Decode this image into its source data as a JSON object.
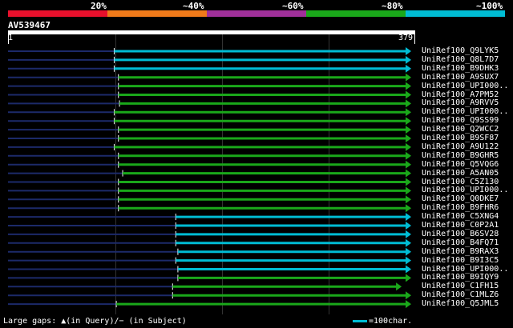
{
  "legend": {
    "labels": [
      "20%",
      "~40%",
      "~60%",
      "~80%",
      "~100%"
    ],
    "colors": [
      "#e8102c",
      "#f07a1a",
      "#a0309a",
      "#1aa81a",
      "#00bcd4"
    ]
  },
  "query": {
    "name": "AV539467",
    "start": "1",
    "end": "379",
    "length": 379
  },
  "hits": [
    {
      "label": "UniRef100_Q9LYK5",
      "start": 100,
      "end": 379,
      "identity": "~100%"
    },
    {
      "label": "UniRef100_Q8L7D7",
      "start": 100,
      "end": 379,
      "identity": "~100%"
    },
    {
      "label": "UniRef100_B9DHK3",
      "start": 100,
      "end": 379,
      "identity": "~100%"
    },
    {
      "label": "UniRef100_A9SUX7",
      "start": 104,
      "end": 379,
      "identity": "~80%"
    },
    {
      "label": "UniRef100_UPI000..",
      "start": 104,
      "end": 379,
      "identity": "~80%"
    },
    {
      "label": "UniRef100_A7PM52",
      "start": 104,
      "end": 379,
      "identity": "~80%"
    },
    {
      "label": "UniRef100_A9RVV5",
      "start": 105,
      "end": 379,
      "identity": "~80%"
    },
    {
      "label": "UniRef100_UPI000..",
      "start": 100,
      "end": 379,
      "identity": "~80%"
    },
    {
      "label": "UniRef100_Q9SS99",
      "start": 100,
      "end": 379,
      "identity": "~80%"
    },
    {
      "label": "UniRef100_Q2WCC2",
      "start": 104,
      "end": 379,
      "identity": "~80%"
    },
    {
      "label": "UniRef100_B9SF87",
      "start": 104,
      "end": 379,
      "identity": "~80%"
    },
    {
      "label": "UniRef100_A9U122",
      "start": 100,
      "end": 379,
      "identity": "~80%"
    },
    {
      "label": "UniRef100_B9GHR5",
      "start": 104,
      "end": 379,
      "identity": "~80%"
    },
    {
      "label": "UniRef100_Q5VQG6",
      "start": 104,
      "end": 379,
      "identity": "~80%"
    },
    {
      "label": "UniRef100_A5AN05",
      "start": 108,
      "end": 379,
      "identity": "~80%"
    },
    {
      "label": "UniRef100_C5Z130",
      "start": 104,
      "end": 379,
      "identity": "~80%"
    },
    {
      "label": "UniRef100_UPI000..",
      "start": 104,
      "end": 379,
      "identity": "~80%"
    },
    {
      "label": "UniRef100_Q0DKE7",
      "start": 104,
      "end": 379,
      "identity": "~80%"
    },
    {
      "label": "UniRef100_B9FHR6",
      "start": 104,
      "end": 379,
      "identity": "~80%"
    },
    {
      "label": "UniRef100_C5XNG4",
      "start": 158,
      "end": 379,
      "identity": "~100%"
    },
    {
      "label": "UniRef100_C0P2A1",
      "start": 158,
      "end": 379,
      "identity": "~100%"
    },
    {
      "label": "UniRef100_B6SV28",
      "start": 158,
      "end": 379,
      "identity": "~100%"
    },
    {
      "label": "UniRef100_B4FQ71",
      "start": 158,
      "end": 379,
      "identity": "~100%"
    },
    {
      "label": "UniRef100_B9RAX3",
      "start": 160,
      "end": 379,
      "identity": "~100%"
    },
    {
      "label": "UniRef100_B9I3C5",
      "start": 158,
      "end": 379,
      "identity": "~100%"
    },
    {
      "label": "UniRef100_UPI000..",
      "start": 160,
      "end": 379,
      "identity": "~100%"
    },
    {
      "label": "UniRef100_B9IQY9",
      "start": 160,
      "end": 379,
      "identity": "~80%"
    },
    {
      "label": "UniRef100_C1FH15",
      "start": 155,
      "end": 370,
      "identity": "~80%"
    },
    {
      "label": "UniRef100_C1MLZ6",
      "start": 155,
      "end": 379,
      "identity": "~80%"
    },
    {
      "label": "UniRef100_Q5JML5",
      "start": 102,
      "end": 379,
      "identity": "~80%"
    }
  ],
  "footer": {
    "gaps_text": "Large gaps: ▲(in Query)/− (in Subject)",
    "key_text": "=100char."
  }
}
